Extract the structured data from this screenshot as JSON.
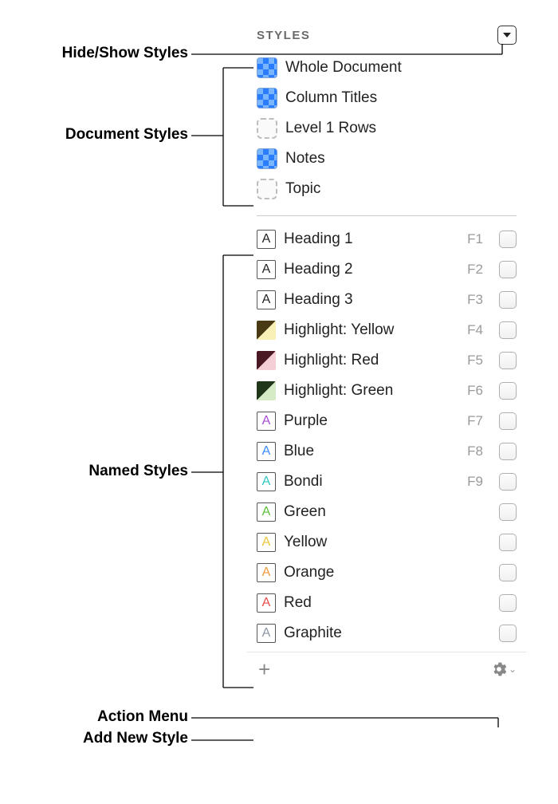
{
  "header": {
    "title": "STYLES"
  },
  "annotations": {
    "hide_show": "Hide/Show Styles",
    "document_styles": "Document Styles",
    "named_styles": "Named Styles",
    "action_menu": "Action Menu",
    "add_new_style": "Add New Style"
  },
  "documentStyles": [
    {
      "label": "Whole Document",
      "icon": "checker"
    },
    {
      "label": "Column Titles",
      "icon": "checker"
    },
    {
      "label": "Level 1 Rows",
      "icon": "dashed"
    },
    {
      "label": "Notes",
      "icon": "checker"
    },
    {
      "label": "Topic",
      "icon": "dashed"
    }
  ],
  "namedStyles": [
    {
      "label": "Heading 1",
      "fkey": "F1",
      "icon": "A",
      "color": "#222"
    },
    {
      "label": "Heading 2",
      "fkey": "F2",
      "icon": "A",
      "color": "#222"
    },
    {
      "label": "Heading 3",
      "fkey": "F3",
      "icon": "A",
      "color": "#222"
    },
    {
      "label": "Highlight: Yellow",
      "fkey": "F4",
      "icon": "HL",
      "c1": "#4a3a14",
      "c2": "#f9f0b8"
    },
    {
      "label": "Highlight: Red",
      "fkey": "F5",
      "icon": "HL",
      "c1": "#4a1822",
      "c2": "#f5cfd6"
    },
    {
      "label": "Highlight: Green",
      "fkey": "F6",
      "icon": "HL",
      "c1": "#1f3618",
      "c2": "#d5ebc5"
    },
    {
      "label": "Purple",
      "fkey": "F7",
      "icon": "A",
      "color": "#a94cd8"
    },
    {
      "label": "Blue",
      "fkey": "F8",
      "icon": "A",
      "color": "#3b8bff"
    },
    {
      "label": "Bondi",
      "fkey": "F9",
      "icon": "A",
      "color": "#2fc7c0"
    },
    {
      "label": "Green",
      "fkey": "",
      "icon": "A",
      "color": "#5bbf3a"
    },
    {
      "label": "Yellow",
      "fkey": "",
      "icon": "A",
      "color": "#e9c63c"
    },
    {
      "label": "Orange",
      "fkey": "",
      "icon": "A",
      "color": "#f29a3f"
    },
    {
      "label": "Red",
      "fkey": "",
      "icon": "A",
      "color": "#e74a4a"
    },
    {
      "label": "Graphite",
      "fkey": "",
      "icon": "A",
      "color": "#8a96a6"
    }
  ]
}
